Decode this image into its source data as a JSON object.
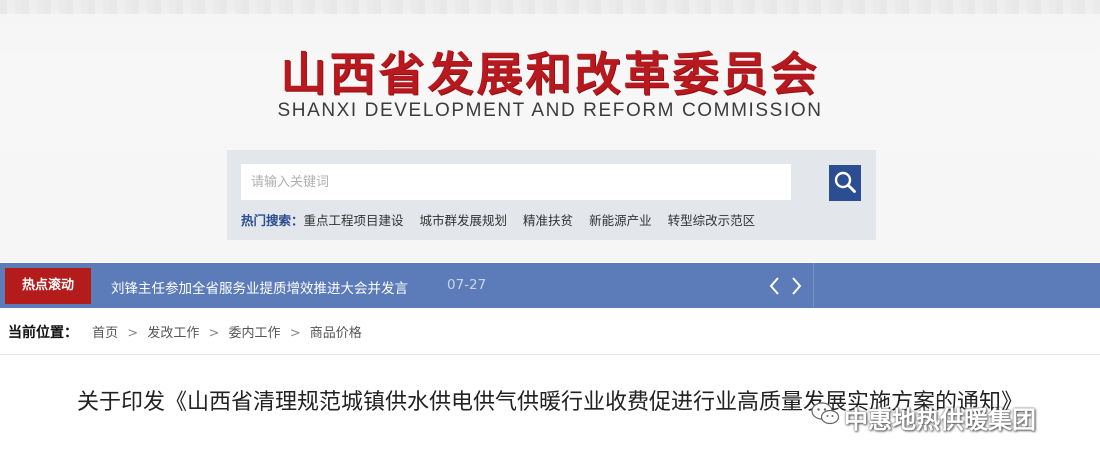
{
  "header": {
    "title": "山西省发展和改革委员会",
    "subtitle": "SHANXI DEVELOPMENT AND REFORM COMMISSION"
  },
  "search": {
    "placeholder": "请输入关键词",
    "button_icon": "search-icon",
    "hot_label": "热门搜索：",
    "hot_terms": [
      "重点工程项目建设",
      "城市群发展规划",
      "精准扶贫",
      "新能源产业",
      "转型综改示范区"
    ]
  },
  "ticker": {
    "tag": "热点滚动",
    "headline": "刘锋主任参加全省服务业提质增效推进大会并发言",
    "date": "07-27",
    "prev_icon": "chevron-left-icon",
    "next_icon": "chevron-right-icon"
  },
  "breadcrumb": {
    "label": "当前位置：",
    "items": [
      "首页",
      "发改工作",
      "委内工作",
      "商品价格"
    ],
    "separator": ">"
  },
  "article": {
    "title": "关于印发《山西省清理规范城镇供水供电供气供暖行业收费促进行业高质量发展实施方案的通知》"
  },
  "watermark": {
    "text": "中惠地热供暖集团",
    "icon": "wechat-icon"
  },
  "colors": {
    "brand_red": "#b8191e",
    "nav_blue": "#5b7bb9",
    "tag_red": "#b41b1b",
    "search_button": "#2c4d91"
  }
}
